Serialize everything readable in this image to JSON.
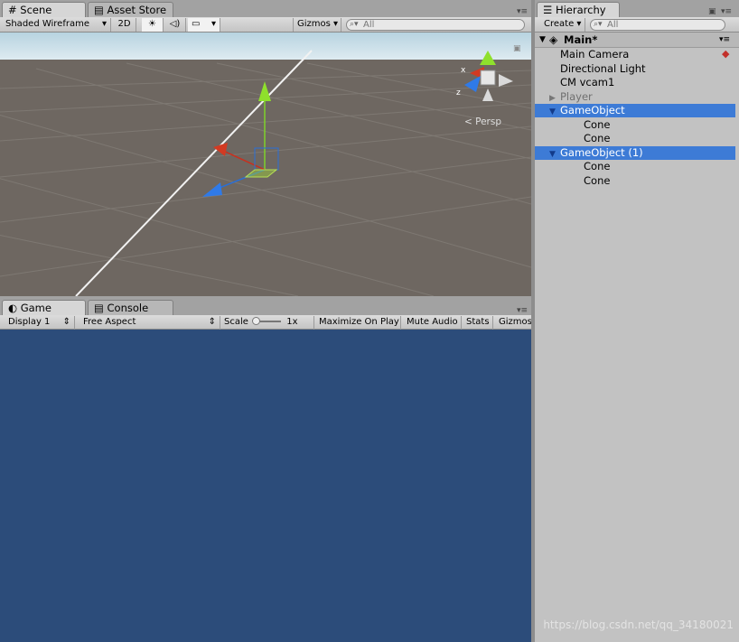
{
  "scene": {
    "tabs": [
      {
        "label": "Scene",
        "icon": "grid-icon",
        "active": true
      },
      {
        "label": "Asset Store",
        "icon": "bag-icon",
        "active": false
      }
    ],
    "toolbar": {
      "shading": "Shaded Wireframe",
      "mode2d": "2D",
      "gizmos": "Gizmos",
      "search_placeholder": "All"
    },
    "persp_label": "Persp",
    "axis_labels": {
      "x": "x",
      "z": "z"
    }
  },
  "game": {
    "tabs": [
      {
        "label": "Game",
        "icon": "pacman-icon",
        "active": true
      },
      {
        "label": "Console",
        "icon": "console-icon",
        "active": false
      }
    ],
    "toolbar": {
      "display": "Display 1",
      "aspect": "Free Aspect",
      "scale_label": "Scale",
      "scale_value": "1x",
      "maximize": "Maximize On Play",
      "mute": "Mute Audio",
      "stats": "Stats",
      "gizmos": "Gizmos"
    },
    "background": "#2c4c7a"
  },
  "hierarchy": {
    "tab_label": "Hierarchy",
    "create": "Create",
    "search_placeholder": "All",
    "scene_name": "Main*",
    "items": [
      {
        "label": "Main Camera",
        "indent": 1,
        "selected": false,
        "expander": "none"
      },
      {
        "label": "Directional Light",
        "indent": 1,
        "selected": false,
        "expander": "none"
      },
      {
        "label": "CM vcam1",
        "indent": 1,
        "selected": false,
        "expander": "none"
      },
      {
        "label": "Player",
        "indent": 1,
        "selected": false,
        "expander": "collapsed"
      },
      {
        "label": "GameObject",
        "indent": 1,
        "selected": true,
        "expander": "expanded"
      },
      {
        "label": "Cone",
        "indent": 2,
        "selected": false,
        "expander": "none"
      },
      {
        "label": "Cone",
        "indent": 2,
        "selected": false,
        "expander": "none"
      },
      {
        "label": "GameObject (1)",
        "indent": 1,
        "selected": true,
        "expander": "expanded"
      },
      {
        "label": "Cone",
        "indent": 2,
        "selected": false,
        "expander": "none"
      },
      {
        "label": "Cone",
        "indent": 2,
        "selected": false,
        "expander": "none"
      }
    ]
  },
  "watermark": "https://blog.csdn.net/qq_34180021",
  "colors": {
    "selection": "#3d7bd6",
    "game_bg": "#2c4c7a",
    "sky": "#c8dee8",
    "ground": "#6e6761"
  }
}
